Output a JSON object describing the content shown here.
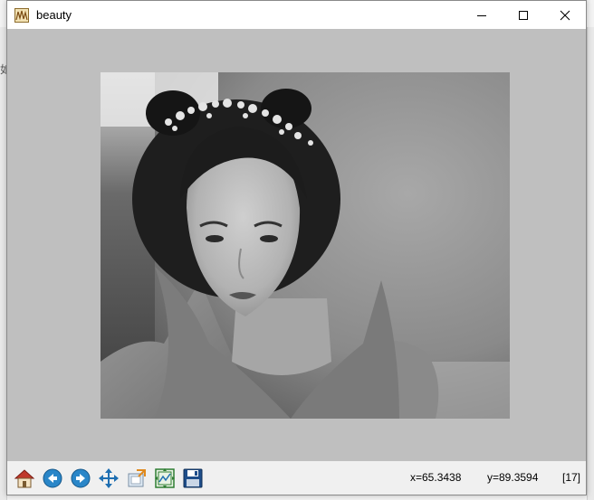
{
  "window": {
    "title": "beauty"
  },
  "background": {
    "glyph": "如"
  },
  "toolbar": {
    "buttons": [
      {
        "name": "home",
        "icon": "home-icon"
      },
      {
        "name": "back",
        "icon": "back-arrow-icon"
      },
      {
        "name": "forward",
        "icon": "forward-arrow-icon"
      },
      {
        "name": "pan",
        "icon": "pan-arrows-icon"
      },
      {
        "name": "zoom",
        "icon": "zoom-rect-icon"
      },
      {
        "name": "configure-subplots",
        "icon": "subplots-icon"
      },
      {
        "name": "save",
        "icon": "floppy-disk-icon"
      }
    ]
  },
  "status": {
    "x_readout": "x=65.3438",
    "y_readout": "y=89.3594",
    "pixel_value": "[17]"
  },
  "colors": {
    "canvas_bg": "#bfbfbf",
    "toolbar_bg": "#f0f0f0",
    "home_roof": "#c0392b",
    "nav_blue": "#2a86c8",
    "pan_blue": "#1f6fb2"
  }
}
